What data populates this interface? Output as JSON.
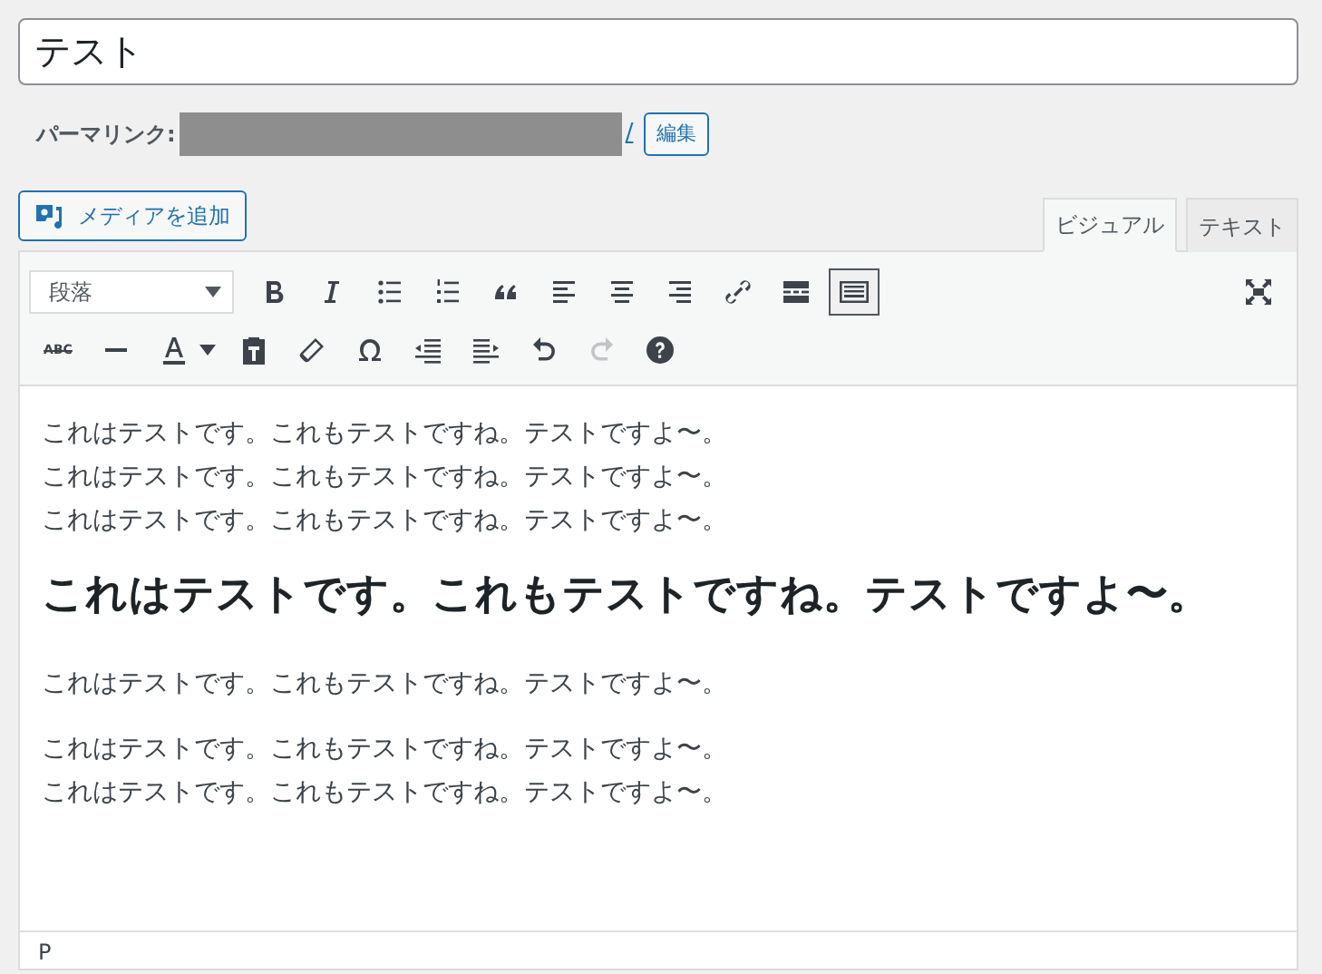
{
  "title_field": {
    "value": "テスト"
  },
  "permalink": {
    "label": "パーマリンク:",
    "redacted": true,
    "slash": "/",
    "edit_button": "編集"
  },
  "add_media_button": "メディアを追加",
  "tabs": [
    {
      "label": "ビジュアル",
      "selected": true
    },
    {
      "label": "テキスト",
      "selected": false
    }
  ],
  "format_select": {
    "value": "段落"
  },
  "toolbar_rows": [
    [
      {
        "kind": "bold",
        "active": false,
        "disabled": false
      },
      {
        "kind": "italic",
        "active": false,
        "disabled": false
      },
      {
        "kind": "bullets",
        "active": false,
        "disabled": false
      },
      {
        "kind": "numbers",
        "active": false,
        "disabled": false
      },
      {
        "kind": "quote",
        "active": false,
        "disabled": false
      },
      {
        "kind": "alignleft",
        "active": false,
        "disabled": false
      },
      {
        "kind": "aligncenter",
        "active": false,
        "disabled": false
      },
      {
        "kind": "alignright",
        "active": false,
        "disabled": false
      },
      {
        "kind": "link",
        "active": false,
        "disabled": false
      },
      {
        "kind": "more",
        "active": false,
        "disabled": false
      },
      {
        "kind": "kitchensink",
        "active": true,
        "disabled": false
      }
    ],
    [
      {
        "kind": "strike",
        "label": "ABC",
        "active": false,
        "disabled": false
      },
      {
        "kind": "hr",
        "active": false,
        "disabled": false
      },
      {
        "kind": "textcolor",
        "active": false,
        "disabled": false
      },
      {
        "kind": "paste",
        "active": false,
        "disabled": false
      },
      {
        "kind": "eraser",
        "active": false,
        "disabled": false
      },
      {
        "kind": "omega",
        "active": false,
        "disabled": false
      },
      {
        "kind": "outdent",
        "active": false,
        "disabled": false
      },
      {
        "kind": "indent",
        "active": false,
        "disabled": false
      },
      {
        "kind": "undo",
        "active": false,
        "disabled": false
      },
      {
        "kind": "redo",
        "active": false,
        "disabled": true
      },
      {
        "kind": "help",
        "active": false,
        "disabled": false
      }
    ]
  ],
  "content": [
    {
      "kind": "p",
      "lines": [
        "これはテストです。これもテストですね。テストですよ〜。",
        "これはテストです。これもテストですね。テストですよ〜。",
        "これはテストです。これもテストですね。テストですよ〜。"
      ]
    },
    {
      "kind": "h2",
      "lines": [
        "これはテストです。これもテストですね。テストですよ〜。"
      ]
    },
    {
      "kind": "p",
      "lines": [
        "これはテストです。これもテストですね。テストですよ〜。"
      ]
    },
    {
      "kind": "p",
      "lines": [
        "これはテストです。これもテストですね。テストですよ〜。",
        "これはテストです。これもテストですね。テストですよ〜。"
      ]
    }
  ],
  "status_bar": {
    "path": "P"
  }
}
